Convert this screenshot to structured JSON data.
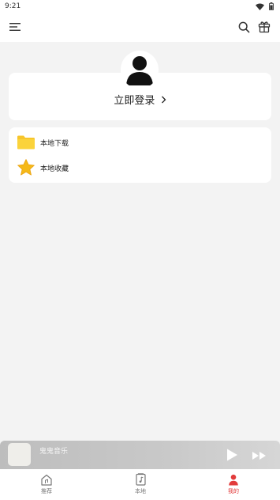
{
  "status_bar": {
    "time": "9:21"
  },
  "profile": {
    "login_label": "立即登录",
    "login_arrow": "›"
  },
  "menu": {
    "items": [
      {
        "label": "本地下载",
        "icon": "folder-icon"
      },
      {
        "label": "本地收藏",
        "icon": "star-icon"
      }
    ]
  },
  "player": {
    "title": "鬼鬼音乐"
  },
  "bottom_nav": {
    "items": [
      {
        "label": "推荐",
        "icon": "home-icon"
      },
      {
        "label": "本地",
        "icon": "music-file-icon"
      },
      {
        "label": "我的",
        "icon": "person-icon"
      }
    ],
    "active_color": "#e23b3b"
  },
  "colors": {
    "folder": "#f7c52b",
    "star": "#f5b919",
    "accent": "#e23b3b"
  }
}
